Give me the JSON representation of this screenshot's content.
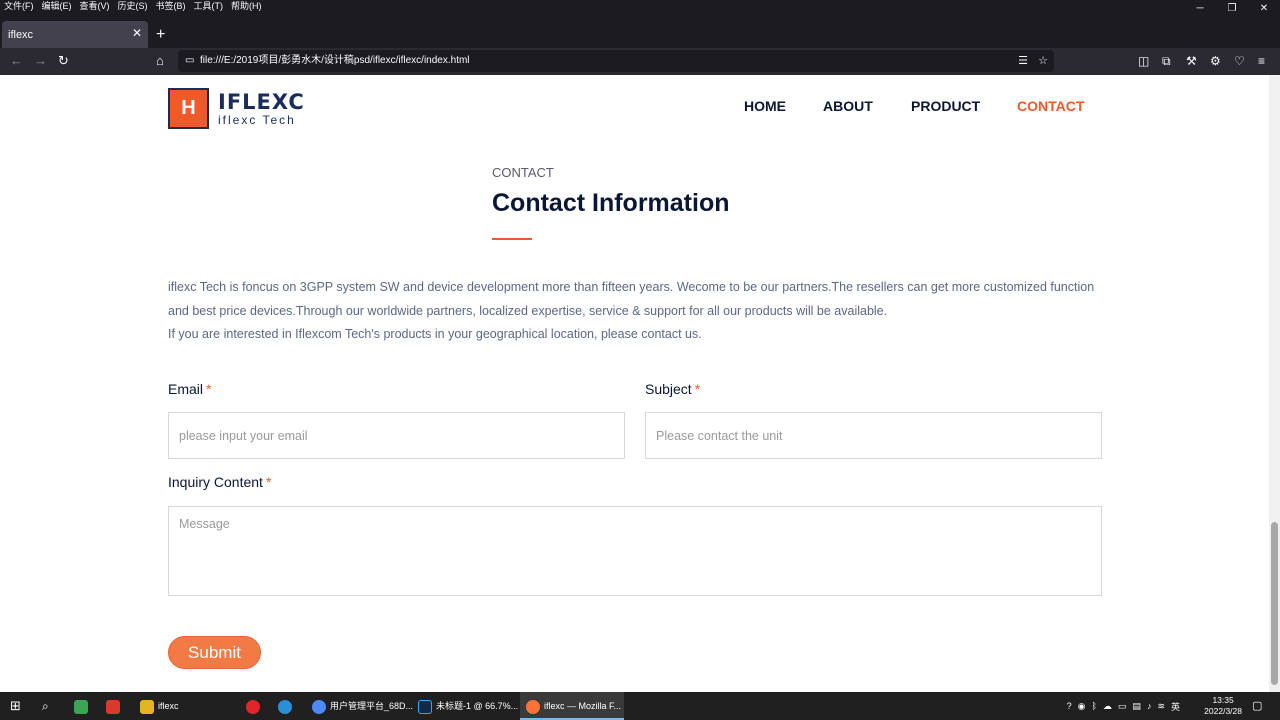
{
  "browser": {
    "menu": [
      "文件(F)",
      "编辑(E)",
      "查看(V)",
      "历史(S)",
      "书签(B)",
      "工具(T)",
      "帮助(H)"
    ],
    "tab_title": "iflexc",
    "url": "file:///E:/2019项目/彭勇水木/设计稿psd/iflexc/iflexc/index.html"
  },
  "site": {
    "logo_brand": "IFLEXC",
    "logo_tagline": "iflexc Tech",
    "logo_mark": "H",
    "nav": [
      {
        "label": "HOME",
        "active": false
      },
      {
        "label": "ABOUT",
        "active": false
      },
      {
        "label": "PRODUCT",
        "active": false
      },
      {
        "label": "CONTACT",
        "active": true
      }
    ],
    "accent_color": "#f05a28",
    "navy_color": "#0b1534"
  },
  "contact": {
    "eyebrow": "CONTACT",
    "title": "Contact Information",
    "intro_1": "iflexc Tech is foncus on 3GPP system SW and device development more than fifteen years. Wecome to be our partners.The resellers can get more customized function and best price devices.Through our worldwide partners, localized expertise, service & support for all our products will be available.",
    "intro_2": "If you are interested in Iflexcom Tech's products in your geographical location, please contact us.",
    "form": {
      "email_label": "Email",
      "email_placeholder": "please input your email",
      "subject_label": "Subject",
      "subject_placeholder": "Please contact the unit",
      "content_label": "Inquiry Content",
      "content_placeholder": "Message",
      "required_mark": "*",
      "submit_label": "Submit"
    }
  },
  "taskbar": {
    "items": [
      "iflexc",
      "用户管理平台_68D...",
      "未标题-1 @ 66.7%...",
      "iflexc — Mozilla F..."
    ],
    "ime": "英",
    "time": "13:35",
    "date": "2022/3/28"
  }
}
